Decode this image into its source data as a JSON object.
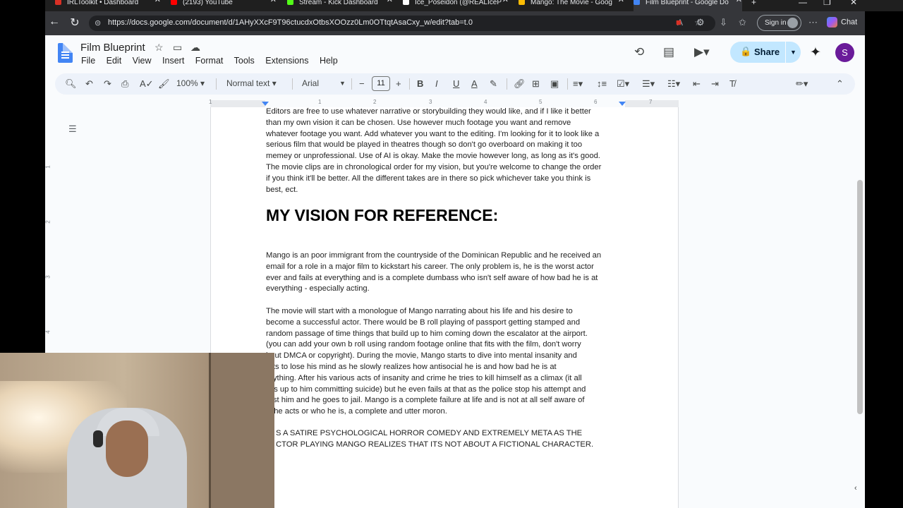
{
  "tabs": [
    {
      "label": "IRLToolkit • Dashboard",
      "color": "#d93025"
    },
    {
      "label": "(2193) YouTube",
      "color": "#ff0000"
    },
    {
      "label": "Stream - Kick Dashboard",
      "color": "#53fc18"
    },
    {
      "label": "Ice_Poseidon (@REALIceP",
      "color": "#ffffff"
    },
    {
      "label": "Mango: The Movie - Goog",
      "color": "#fbbc04"
    },
    {
      "label": "Film Blueprint - Google Do",
      "color": "#4285f4"
    }
  ],
  "address": {
    "url": "https://docs.google.com/document/d/1AHyXXcF9T96ctucdxOtbsXOOzz0Lm0OTtqtAsaCxy_w/edit?tab=t.0",
    "ext_badge": "51",
    "signin_label": "Sign in",
    "chat_label": "Chat"
  },
  "doc": {
    "title": "Film Blueprint",
    "menus": [
      "File",
      "Edit",
      "View",
      "Insert",
      "Format",
      "Tools",
      "Extensions",
      "Help"
    ],
    "share_label": "Share",
    "account_initial": "S"
  },
  "toolbar": {
    "zoom": "100%",
    "style": "Normal text",
    "font": "Arial",
    "font_size": "11"
  },
  "ruler": {
    "numbers": [
      "1",
      "1",
      "2",
      "3",
      "4",
      "5",
      "6",
      "7"
    ],
    "vnumbers": [
      "1",
      "2",
      "3",
      "4"
    ]
  },
  "content": {
    "intro_lines": [
      "Editors are free to use whatever narrative or storybuilding they would like, and if I like it better",
      "than my own vision it can be chosen. Use however much footage you want and remove",
      "whatever footage you want. Add whatever you want to the editing. I'm looking for it to look like a",
      "serious film that would be played in theatres though so don't go overboard on making it too",
      "memey or unprofessional. Use of AI is okay. Make the movie however long, as long as it's good.",
      "The movie clips are in chronological order for my vision, but you're welcome to change the order",
      "if you think it'll be better. All the different takes are in there so pick whichever take you think is",
      "best, ect."
    ],
    "heading": "MY VISION FOR REFERENCE:",
    "para1_lines": [
      "Mango is an poor immigrant from the countryside of the Dominican Republic and he received an",
      "email for a role in a major film to kickstart his career. The only problem is, he is the worst actor",
      "ever and fails at everything and is a complete dumbass who isn't self aware of how bad he is at",
      "everything - especially acting."
    ],
    "para2_lines": [
      "The movie will start with a monologue of Mango narrating about his life and his desire to",
      "become a successful actor. There would be B roll playing of passport getting stamped and",
      "random passage of time things that build up to him coming down the escalator at the airport.",
      "(you can add your own b roll using random footage online that fits with the film, don't worry",
      "bout DMCA or copyright). During the movie, Mango starts to dive into mental insanity and",
      "arts to lose his mind as he slowly realizes how antisocial he is and how bad he is at",
      "erything. After his various acts of insanity and crime he tries to kill himself as a climax (it all",
      "ilds up to him committing suicide) but he even fails at that as the police stop his attempt and",
      "rest him and he goes to jail. Mango is a complete failure at life and is not at all self aware of",
      "w he acts or who he is, a complete and utter moron."
    ],
    "para3_lines": [
      "S A SATIRE PSYCHOLOGICAL HORROR COMEDY AND EXTREMELY META AS THE",
      "CTOR PLAYING MANGO REALIZES THAT ITS NOT ABOUT A FICTIONAL CHARACTER."
    ]
  }
}
